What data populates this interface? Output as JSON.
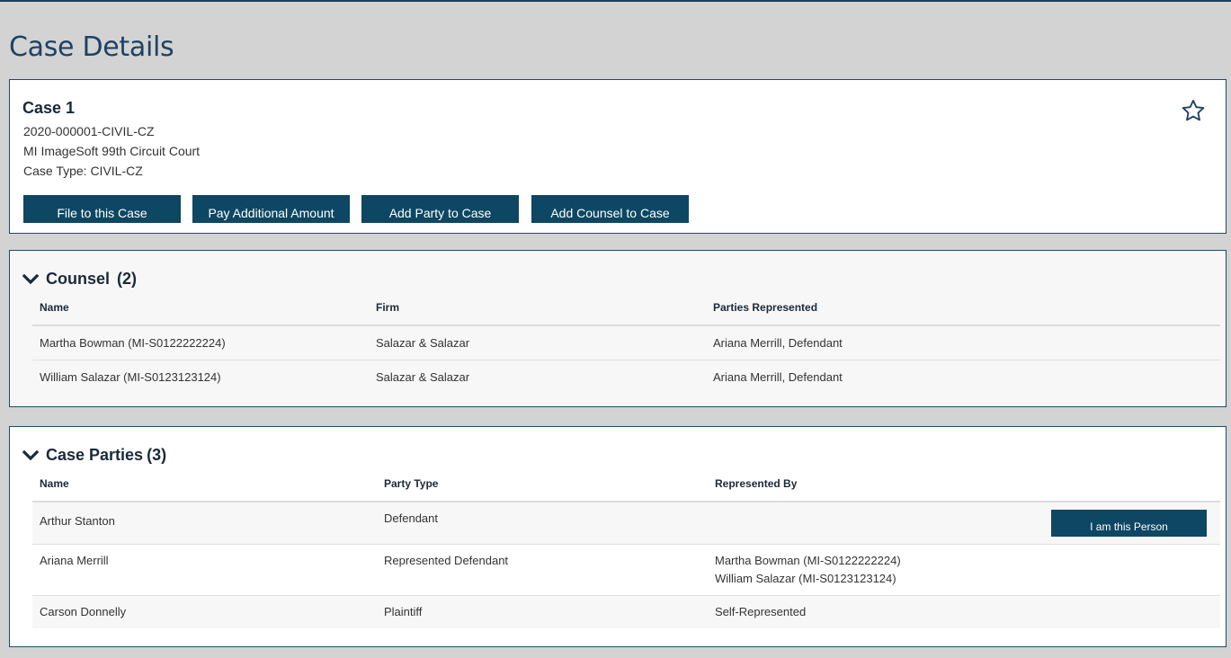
{
  "page": {
    "title": "Case Details"
  },
  "case": {
    "title": "Case 1",
    "number": "2020-000001-CIVIL-CZ",
    "court": "MI ImageSoft 99th Circuit Court",
    "case_type": "Case Type: CIVIL-CZ",
    "favorite_icon": "star-outline-icon",
    "actions": {
      "file": "File to this Case",
      "pay": "Pay Additional Amount",
      "add_party": "Add Party to Case",
      "add_counsel": "Add Counsel to Case"
    }
  },
  "counsel": {
    "title": "Counsel",
    "count": "(2)",
    "columns": {
      "name": "Name",
      "firm": "Firm",
      "parties": "Parties Represented"
    },
    "rows": [
      {
        "name": "Martha Bowman (MI-S0122222224)",
        "firm": "Salazar & Salazar",
        "parties": "Ariana Merrill, Defendant"
      },
      {
        "name": "William Salazar (MI-S0123123124)",
        "firm": "Salazar & Salazar",
        "parties": "Ariana Merrill, Defendant"
      }
    ]
  },
  "parties": {
    "title": "Case Parties",
    "count": "(3)",
    "columns": {
      "name": "Name",
      "type": "Party Type",
      "represented": "Represented By"
    },
    "rows": [
      {
        "name": "Arthur Stanton",
        "type": "Defendant",
        "represented": [
          "",
          ""
        ],
        "action": "I am this Person"
      },
      {
        "name": "Ariana Merrill",
        "type": "Represented Defendant",
        "represented": [
          "Martha Bowman (MI-S0122222224)",
          "William Salazar (MI-S0123123124)"
        ]
      },
      {
        "name": "Carson Donnelly",
        "type": "Plaintiff",
        "represented": [
          "Self-Represented",
          ""
        ]
      }
    ]
  },
  "colors": {
    "primary": "#0e4763",
    "title": "#1e4263",
    "background": "#d3d3d3"
  }
}
